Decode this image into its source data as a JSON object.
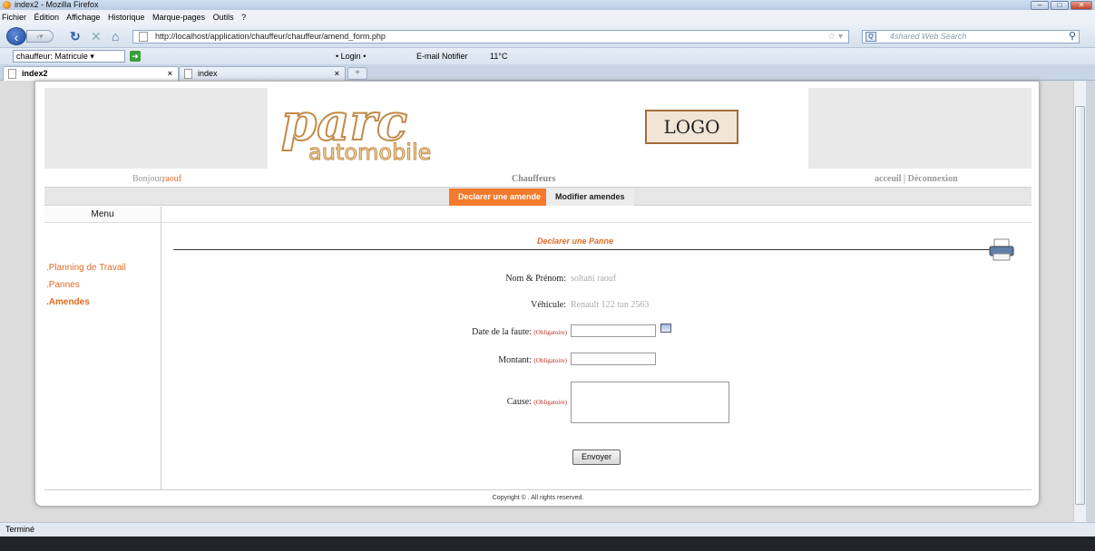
{
  "window": {
    "title": "index2 - Mozilla Firefox"
  },
  "menubar": [
    "Fichier",
    "Édition",
    "Affichage",
    "Historique",
    "Marque-pages",
    "Outils",
    "?"
  ],
  "navbar": {
    "url": "http://localhost/application/chauffeur/chauffeur/amend_form.php",
    "search_placeholder": "4shared Web Search"
  },
  "toolbar": {
    "select_value": "chauffeur:   Matricule",
    "login": "Login",
    "extra": "E-mail Notifier",
    "weather": "11°C"
  },
  "tabs": [
    {
      "label": "index2"
    },
    {
      "label": "index"
    }
  ],
  "site": {
    "logo_text1": "parc",
    "logo_text2": "automobile",
    "logo_box": "LOGO",
    "greeting": "Bonjour,",
    "username": "raouf",
    "section_title": "Chauffeurs",
    "account_links": "acceuil | Déconnexion",
    "nav_tabs": [
      "Declarer une amende",
      "Modifier amendes"
    ],
    "menu_header": "Menu",
    "side_menu": [
      ".Planning de Travail",
      ".Pannes",
      ".Amendes"
    ]
  },
  "form": {
    "title": "Declarer une Panne",
    "name_label": "Nom & Prénom:",
    "name_value": "soltani  raouf",
    "vehicle_label": "Véhicule:",
    "vehicle_value": "Renault  122 tun 2563",
    "date_label": "Date de la faute:",
    "amount_label": "Montant:",
    "cause_label": "Cause:",
    "required": "(Obligatoire)",
    "submit": "Envoyer"
  },
  "footer": {
    "copyright": "Copyright © . All rights reserved."
  },
  "status": {
    "text": "Terminé"
  }
}
